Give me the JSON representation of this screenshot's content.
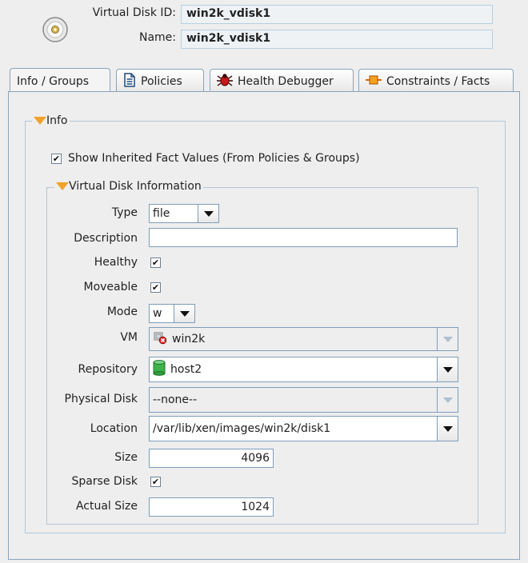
{
  "header": {
    "vdisk_id_label": "Virtual Disk ID:",
    "vdisk_id_value": "win2k_vdisk1",
    "name_label": "Name:",
    "name_value": "win2k_vdisk1",
    "icon": "disc-icon"
  },
  "tabs": [
    {
      "label": "Info / Groups",
      "icon": "",
      "active": true
    },
    {
      "label": "Policies",
      "icon": "document-icon",
      "active": false
    },
    {
      "label": "Health Debugger",
      "icon": "bug-icon",
      "active": false
    },
    {
      "label": "Constraints / Facts",
      "icon": "constraint-icon",
      "active": false
    }
  ],
  "info_group": {
    "title": "Info",
    "show_inherited_label": "Show Inherited Fact Values (From Policies & Groups)",
    "show_inherited_checked": true
  },
  "vdisk_group": {
    "title": "Virtual Disk Information",
    "fields": {
      "type": {
        "label": "Type",
        "value": "file"
      },
      "description": {
        "label": "Description",
        "value": ""
      },
      "healthy": {
        "label": "Healthy",
        "checked": true
      },
      "moveable": {
        "label": "Moveable",
        "checked": true
      },
      "mode": {
        "label": "Mode",
        "value": "w"
      },
      "vm": {
        "label": "VM",
        "value": "win2k",
        "icon": "vm-error-icon"
      },
      "repository": {
        "label": "Repository",
        "value": "host2",
        "icon": "repository-icon"
      },
      "physical_disk": {
        "label": "Physical Disk",
        "value": "--none--"
      },
      "location": {
        "label": "Location",
        "value": "/var/lib/xen/images/win2k/disk1"
      },
      "size": {
        "label": "Size",
        "value": "4096"
      },
      "sparse_disk": {
        "label": "Sparse Disk",
        "checked": true
      },
      "actual_size": {
        "label": "Actual Size",
        "value": "1024"
      }
    }
  },
  "checkmark": "✔",
  "colors": {
    "accent_border": "#7f9db9",
    "group_border": "#b3c6d6",
    "legend_triangle": "#f0a22a"
  }
}
